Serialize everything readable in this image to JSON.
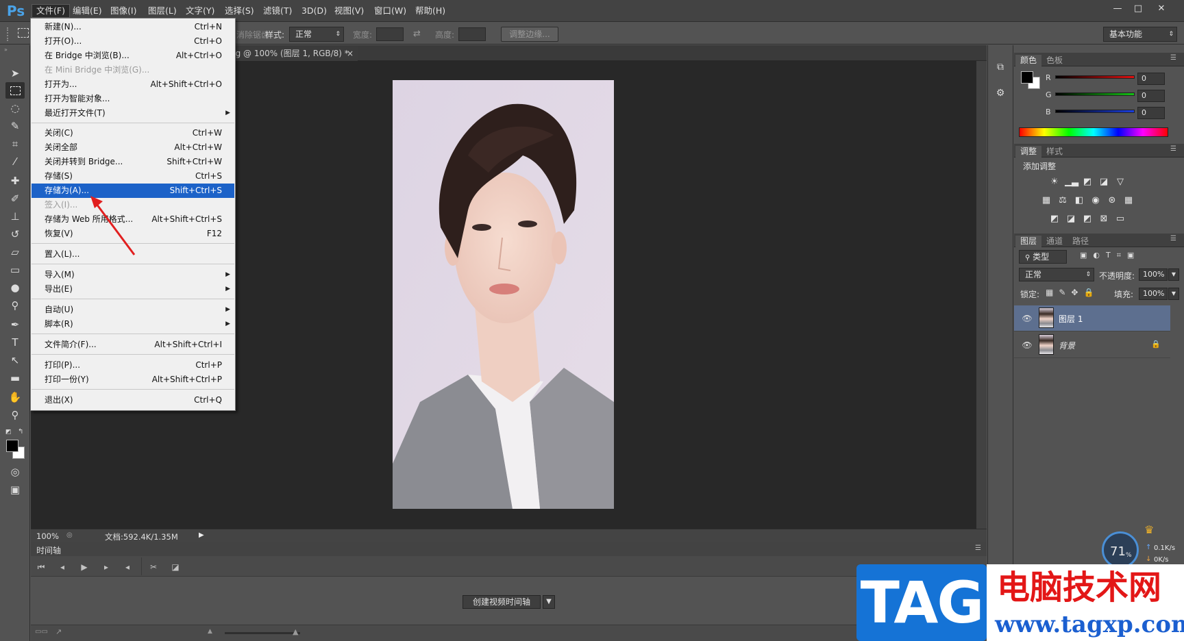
{
  "app": {
    "logo": "Ps"
  },
  "menubar": {
    "items": [
      "文件(F)",
      "编辑(E)",
      "图像(I)",
      "图层(L)",
      "文字(Y)",
      "选择(S)",
      "滤镜(T)",
      "3D(D)",
      "视图(V)",
      "窗口(W)",
      "帮助(H)"
    ],
    "window_controls": [
      "—",
      "□",
      "✕"
    ]
  },
  "optionsbar": {
    "feather_partial": "消除锯齿",
    "style_label": "样式:",
    "style_value": "正常",
    "width_label": "宽度:",
    "height_label": "高度:",
    "refine_edge": "调整边缘...",
    "workspace": "基本功能"
  },
  "document": {
    "tab_title": "ng @ 100% (图层 1, RGB/8) *",
    "tab_close": "×",
    "zoom": "100%",
    "doc_info": "文档:592.4K/1.35M"
  },
  "file_menu": {
    "items": [
      {
        "label": "新建(N)...",
        "shortcut": "Ctrl+N"
      },
      {
        "label": "打开(O)...",
        "shortcut": "Ctrl+O"
      },
      {
        "label": "在 Bridge 中浏览(B)...",
        "shortcut": "Alt+Ctrl+O"
      },
      {
        "label": "在 Mini Bridge 中浏览(G)...",
        "shortcut": ""
      },
      {
        "label": "打开为...",
        "shortcut": "Alt+Shift+Ctrl+O"
      },
      {
        "label": "打开为智能对象...",
        "shortcut": ""
      },
      {
        "label": "最近打开文件(T)",
        "shortcut": ""
      },
      {
        "label": "关闭(C)",
        "shortcut": "Ctrl+W"
      },
      {
        "label": "关闭全部",
        "shortcut": "Alt+Ctrl+W"
      },
      {
        "label": "关闭并转到 Bridge...",
        "shortcut": "Shift+Ctrl+W"
      },
      {
        "label": "存储(S)",
        "shortcut": "Ctrl+S"
      },
      {
        "label": "存储为(A)...",
        "shortcut": "Shift+Ctrl+S"
      },
      {
        "label": "签入(I)...",
        "shortcut": ""
      },
      {
        "label": "存储为 Web 所用格式...",
        "shortcut": "Alt+Shift+Ctrl+S"
      },
      {
        "label": "恢复(V)",
        "shortcut": "F12"
      },
      {
        "label": "置入(L)...",
        "shortcut": ""
      },
      {
        "label": "导入(M)",
        "shortcut": ""
      },
      {
        "label": "导出(E)",
        "shortcut": ""
      },
      {
        "label": "自动(U)",
        "shortcut": ""
      },
      {
        "label": "脚本(R)",
        "shortcut": ""
      },
      {
        "label": "文件简介(F)...",
        "shortcut": "Alt+Shift+Ctrl+I"
      },
      {
        "label": "打印(P)...",
        "shortcut": "Ctrl+P"
      },
      {
        "label": "打印一份(Y)",
        "shortcut": "Alt+Shift+Ctrl+P"
      },
      {
        "label": "退出(X)",
        "shortcut": "Ctrl+Q"
      }
    ],
    "highlighted": "存储为(A)..."
  },
  "color_panel": {
    "tabs": [
      "颜色",
      "色板"
    ],
    "channels": [
      {
        "label": "R",
        "value": "0"
      },
      {
        "label": "G",
        "value": "0"
      },
      {
        "label": "B",
        "value": "0"
      }
    ],
    "colors": {
      "r": "#e01010",
      "g": "#14c214",
      "b": "#1a3ee0"
    }
  },
  "adjust_panel": {
    "tabs": [
      "调整",
      "样式"
    ],
    "title": "添加调整"
  },
  "layers_panel": {
    "tabs": [
      "图层",
      "通道",
      "路径"
    ],
    "filter": "类型",
    "blend_mode": "正常",
    "opacity_label": "不透明度:",
    "opacity_value": "100%",
    "lock_label": "锁定:",
    "fill_label": "填充:",
    "fill_value": "100%",
    "layers": [
      {
        "name": "图层 1",
        "selected": true
      },
      {
        "name": "背景",
        "selected": false
      }
    ]
  },
  "timeline": {
    "title": "时间轴",
    "create_button": "创建视频时间轴"
  },
  "network": {
    "percent": "71",
    "percent_unit": "%",
    "up": "0.1K/s",
    "down": "0K/s"
  },
  "watermark": {
    "tag": "TAG",
    "site_name": "电脑技术网",
    "url": "www.tagxp.com"
  }
}
